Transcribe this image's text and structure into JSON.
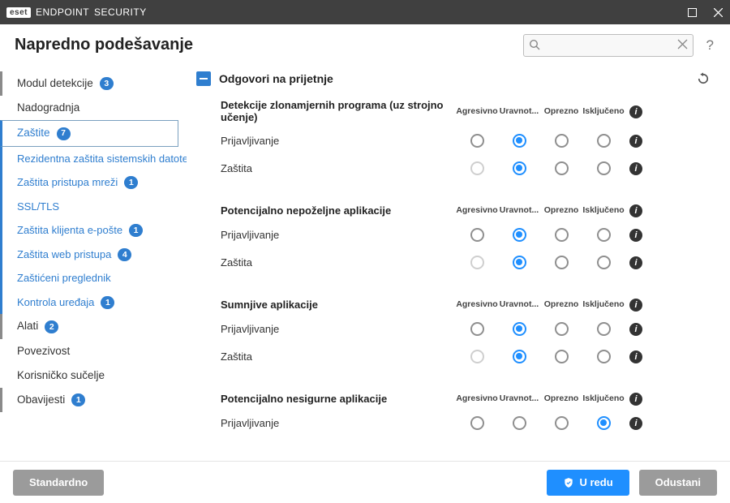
{
  "titlebar": {
    "brand": "eset",
    "product_bold": "ENDPOINT",
    "product_light": "SECURITY"
  },
  "header": {
    "title": "Napredno podešavanje",
    "search_placeholder": ""
  },
  "sidebar": {
    "items": [
      {
        "label": "Modul detekcije",
        "badge": "3",
        "kind": "top-bar"
      },
      {
        "label": "Nadogradnja",
        "kind": "top"
      },
      {
        "label": "Zaštite",
        "badge": "7",
        "kind": "active-parent"
      },
      {
        "label": "Rezidentna zaštita sistemskih datoteka",
        "kind": "child"
      },
      {
        "label": "Zaštita pristupa mreži",
        "badge": "1",
        "kind": "child"
      },
      {
        "label": "SSL/TLS",
        "kind": "child"
      },
      {
        "label": "Zaštita klijenta e-pošte",
        "badge": "1",
        "kind": "child"
      },
      {
        "label": "Zaštita web pristupa",
        "badge": "4",
        "kind": "child"
      },
      {
        "label": "Zaštićeni preglednik",
        "kind": "child"
      },
      {
        "label": "Kontrola uređaja",
        "badge": "1",
        "kind": "child"
      },
      {
        "label": "Alati",
        "badge": "2",
        "kind": "top-bar"
      },
      {
        "label": "Povezivost",
        "kind": "top"
      },
      {
        "label": "Korisničko sučelje",
        "kind": "top"
      },
      {
        "label": "Obavijesti",
        "badge": "1",
        "kind": "top-bar"
      }
    ]
  },
  "section": {
    "title": "Odgovori na prijetnje",
    "columns": [
      "Agresivno",
      "Uravnot...",
      "Oprezno",
      "Isključeno"
    ],
    "groups": [
      {
        "title": "Detekcije zlonamjernih programa (uz strojno učenje)",
        "rows": [
          {
            "label": "Prijavljivanje",
            "selected": 1,
            "disabled": []
          },
          {
            "label": "Zaštita",
            "selected": 1,
            "disabled": [
              0
            ]
          }
        ]
      },
      {
        "title": "Potencijalno nepoželjne aplikacije",
        "rows": [
          {
            "label": "Prijavljivanje",
            "selected": 1,
            "disabled": []
          },
          {
            "label": "Zaštita",
            "selected": 1,
            "disabled": [
              0
            ]
          }
        ]
      },
      {
        "title": "Sumnjive aplikacije",
        "rows": [
          {
            "label": "Prijavljivanje",
            "selected": 1,
            "disabled": []
          },
          {
            "label": "Zaštita",
            "selected": 1,
            "disabled": [
              0
            ]
          }
        ]
      },
      {
        "title": "Potencijalno nesigurne aplikacije",
        "rows": [
          {
            "label": "Prijavljivanje",
            "selected": 3,
            "disabled": []
          }
        ]
      }
    ]
  },
  "footer": {
    "default": "Standardno",
    "ok": "U redu",
    "cancel": "Odustani"
  }
}
